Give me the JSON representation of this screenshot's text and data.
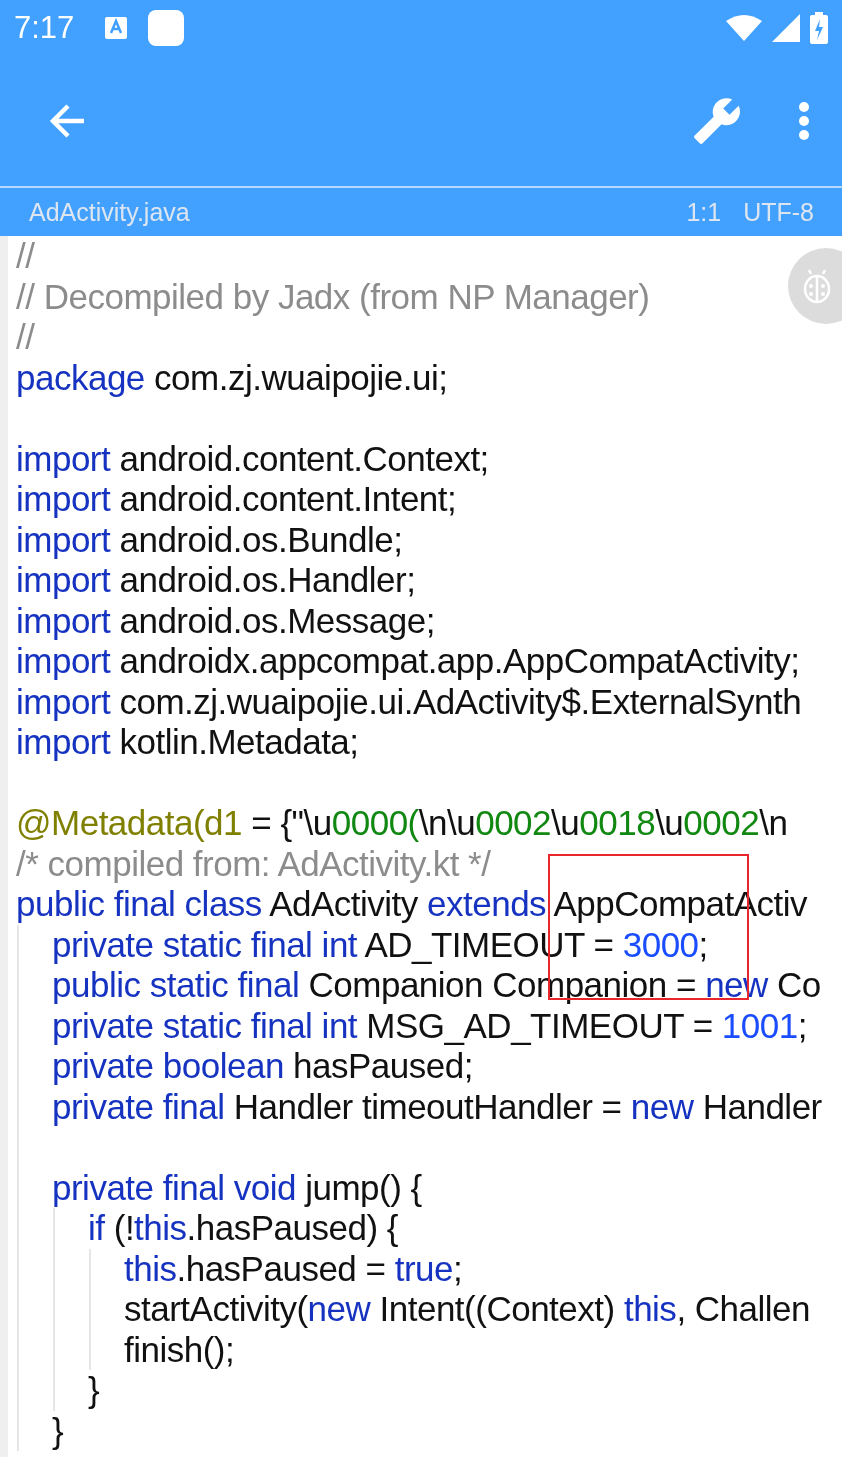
{
  "status_bar": {
    "time": "7:17"
  },
  "file_bar": {
    "file_name": "AdActivity.java",
    "position": "1:1",
    "encoding": "UTF-8"
  },
  "code_lines": [
    {
      "kind": "code",
      "tokens": [
        {
          "kind": "comment",
          "text": "//"
        }
      ]
    },
    {
      "kind": "code",
      "tokens": [
        {
          "kind": "comment",
          "text": "// Decompiled by Jadx (from NP Manager)"
        }
      ]
    },
    {
      "kind": "code",
      "tokens": [
        {
          "kind": "comment",
          "text": "//"
        }
      ]
    },
    {
      "kind": "code",
      "tokens": [
        {
          "kind": "keyword",
          "text": "package"
        },
        {
          "kind": "plain",
          "text": " com.zj.wuaipojie.ui;"
        }
      ]
    },
    {
      "kind": "blank"
    },
    {
      "kind": "code",
      "tokens": [
        {
          "kind": "keyword",
          "text": "import"
        },
        {
          "kind": "plain",
          "text": " android.content.Context;"
        }
      ]
    },
    {
      "kind": "code",
      "tokens": [
        {
          "kind": "keyword",
          "text": "import"
        },
        {
          "kind": "plain",
          "text": " android.content.Intent;"
        }
      ]
    },
    {
      "kind": "code",
      "tokens": [
        {
          "kind": "keyword",
          "text": "import"
        },
        {
          "kind": "plain",
          "text": " android.os.Bundle;"
        }
      ]
    },
    {
      "kind": "code",
      "tokens": [
        {
          "kind": "keyword",
          "text": "import"
        },
        {
          "kind": "plain",
          "text": " android.os.Handler;"
        }
      ]
    },
    {
      "kind": "code",
      "tokens": [
        {
          "kind": "keyword",
          "text": "import"
        },
        {
          "kind": "plain",
          "text": " android.os.Message;"
        }
      ]
    },
    {
      "kind": "code",
      "tokens": [
        {
          "kind": "keyword",
          "text": "import"
        },
        {
          "kind": "plain",
          "text": " androidx.appcompat.app.AppCompatActivity;"
        }
      ]
    },
    {
      "kind": "code",
      "tokens": [
        {
          "kind": "keyword",
          "text": "import"
        },
        {
          "kind": "plain",
          "text": " com.zj.wuaipojie.ui.AdActivity$.ExternalSynth"
        }
      ]
    },
    {
      "kind": "code",
      "tokens": [
        {
          "kind": "keyword",
          "text": "import"
        },
        {
          "kind": "plain",
          "text": " kotlin.Metadata;"
        }
      ]
    },
    {
      "kind": "blank"
    },
    {
      "kind": "code",
      "tokens": [
        {
          "kind": "annotation",
          "text": "@Metadata(d1"
        },
        {
          "kind": "plain",
          "text": " = {\"\\u"
        },
        {
          "kind": "string",
          "text": "0000("
        },
        {
          "kind": "plain",
          "text": "\\n\\u"
        },
        {
          "kind": "string",
          "text": "0002"
        },
        {
          "kind": "plain",
          "text": "\\u"
        },
        {
          "kind": "string",
          "text": "0018"
        },
        {
          "kind": "plain",
          "text": "\\u"
        },
        {
          "kind": "string",
          "text": "0002"
        },
        {
          "kind": "plain",
          "text": "\\n"
        }
      ]
    },
    {
      "kind": "code",
      "tokens": [
        {
          "kind": "comment",
          "text": "/* compiled from: AdActivity.kt */"
        }
      ]
    },
    {
      "kind": "code",
      "tokens": [
        {
          "kind": "keyword",
          "text": "public final class"
        },
        {
          "kind": "plain",
          "text": " AdActivity "
        },
        {
          "kind": "keyword",
          "text": "extends"
        },
        {
          "kind": "plain",
          "text": " AppCompatActiv"
        }
      ],
      "children": [
        {
          "kind": "code",
          "tokens": [
            {
              "kind": "keyword",
              "text": "private static final int"
            },
            {
              "kind": "plain",
              "text": " AD_TIMEOUT = "
            },
            {
              "kind": "number",
              "text": "3000"
            },
            {
              "kind": "plain",
              "text": ";"
            }
          ]
        },
        {
          "kind": "code",
          "tokens": [
            {
              "kind": "keyword",
              "text": "public static final"
            },
            {
              "kind": "plain",
              "text": " Companion Companion = "
            },
            {
              "kind": "keyword",
              "text": "new"
            },
            {
              "kind": "plain",
              "text": " Co"
            }
          ]
        },
        {
          "kind": "code",
          "tokens": [
            {
              "kind": "keyword",
              "text": "private static final int"
            },
            {
              "kind": "plain",
              "text": " MSG_AD_TIMEOUT = "
            },
            {
              "kind": "number",
              "text": "1001"
            },
            {
              "kind": "plain",
              "text": ";"
            }
          ]
        },
        {
          "kind": "code",
          "tokens": [
            {
              "kind": "keyword",
              "text": "private boolean"
            },
            {
              "kind": "plain",
              "text": " hasPaused;"
            }
          ]
        },
        {
          "kind": "code",
          "tokens": [
            {
              "kind": "keyword",
              "text": "private final"
            },
            {
              "kind": "plain",
              "text": " Handler timeoutHandler = "
            },
            {
              "kind": "keyword",
              "text": "new"
            },
            {
              "kind": "plain",
              "text": " Handler"
            }
          ]
        },
        {
          "kind": "blank"
        },
        {
          "kind": "code",
          "tokens": [
            {
              "kind": "keyword",
              "text": "private final void"
            },
            {
              "kind": "plain",
              "text": " jump() {"
            }
          ],
          "children": [
            {
              "kind": "code",
              "tokens": [
                {
                  "kind": "keyword",
                  "text": "if"
                },
                {
                  "kind": "plain",
                  "text": " (!"
                },
                {
                  "kind": "keyword",
                  "text": "this"
                },
                {
                  "kind": "plain",
                  "text": ".hasPaused) {"
                }
              ],
              "children": [
                {
                  "kind": "code",
                  "tokens": [
                    {
                      "kind": "keyword",
                      "text": "this"
                    },
                    {
                      "kind": "plain",
                      "text": ".hasPaused = "
                    },
                    {
                      "kind": "keyword",
                      "text": "true"
                    },
                    {
                      "kind": "plain",
                      "text": ";"
                    }
                  ]
                },
                {
                  "kind": "code",
                  "tokens": [
                    {
                      "kind": "plain",
                      "text": "startActivity("
                    },
                    {
                      "kind": "keyword",
                      "text": "new"
                    },
                    {
                      "kind": "plain",
                      "text": " Intent((Context) "
                    },
                    {
                      "kind": "keyword",
                      "text": "this"
                    },
                    {
                      "kind": "plain",
                      "text": ", Challen"
                    }
                  ]
                },
                {
                  "kind": "code",
                  "tokens": [
                    {
                      "kind": "plain",
                      "text": "finish();"
                    }
                  ]
                }
              ]
            },
            {
              "kind": "code",
              "tokens": [
                {
                  "kind": "plain",
                  "text": "}"
                }
              ]
            }
          ]
        },
        {
          "kind": "code",
          "tokens": [
            {
              "kind": "plain",
              "text": "}"
            }
          ]
        }
      ]
    }
  ],
  "overlay_mark": {
    "kind": "rectangle",
    "color": "#e8262b"
  },
  "floating_button": {
    "kind": "debug"
  }
}
